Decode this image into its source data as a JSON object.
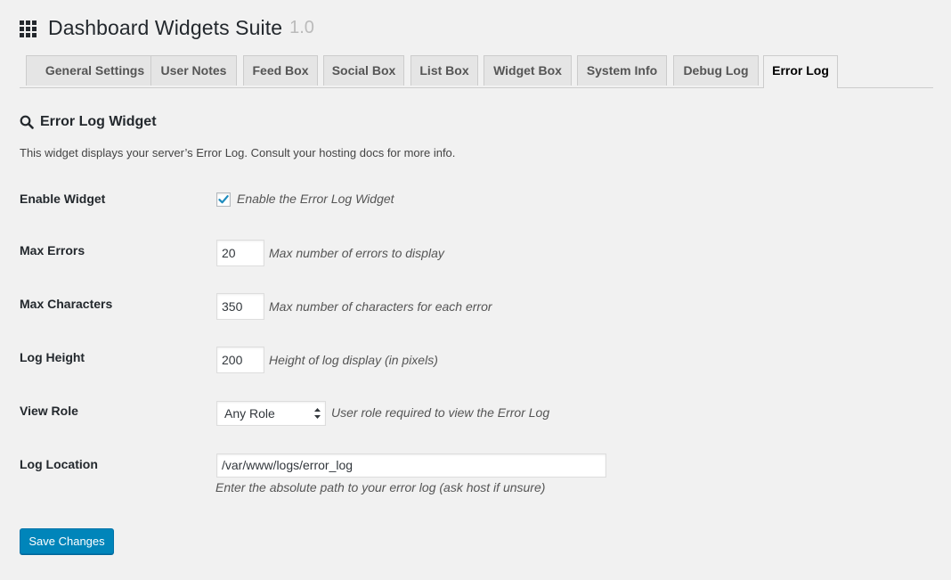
{
  "header": {
    "title": "Dashboard Widgets Suite",
    "version": "1.0",
    "icon": "grid-icon"
  },
  "tabs": [
    {
      "label": "General Settings",
      "active": false
    },
    {
      "label": "User Notes",
      "active": false
    },
    {
      "label": "Feed Box",
      "active": false
    },
    {
      "label": "Social Box",
      "active": false
    },
    {
      "label": "List Box",
      "active": false
    },
    {
      "label": "Widget Box",
      "active": false
    },
    {
      "label": "System Info",
      "active": false
    },
    {
      "label": "Debug Log",
      "active": false
    },
    {
      "label": "Error Log",
      "active": true
    }
  ],
  "section": {
    "title": "Error Log Widget",
    "icon": "search-icon",
    "description": "This widget displays your server’s Error Log. Consult your hosting docs for more info."
  },
  "fields": {
    "enable": {
      "label": "Enable Widget",
      "checkbox_label": "Enable the Error Log Widget",
      "checked": true
    },
    "max_errors": {
      "label": "Max Errors",
      "value": "20",
      "hint": "Max number of errors to display"
    },
    "max_chars": {
      "label": "Max Characters",
      "value": "350",
      "hint": "Max number of characters for each error"
    },
    "log_height": {
      "label": "Log Height",
      "value": "200",
      "hint": "Height of log display (in pixels)"
    },
    "view_role": {
      "label": "View Role",
      "selected": "Any Role",
      "hint": "User role required to view the Error Log"
    },
    "log_location": {
      "label": "Log Location",
      "value": "/var/www/logs/error_log",
      "hint": "Enter the absolute path to your error log (ask host if unsure)"
    }
  },
  "save_button": {
    "label": "Save Changes"
  },
  "colors": {
    "accent": "#0085ba",
    "background": "#f1f1f1",
    "check": "#1e8cbe"
  }
}
